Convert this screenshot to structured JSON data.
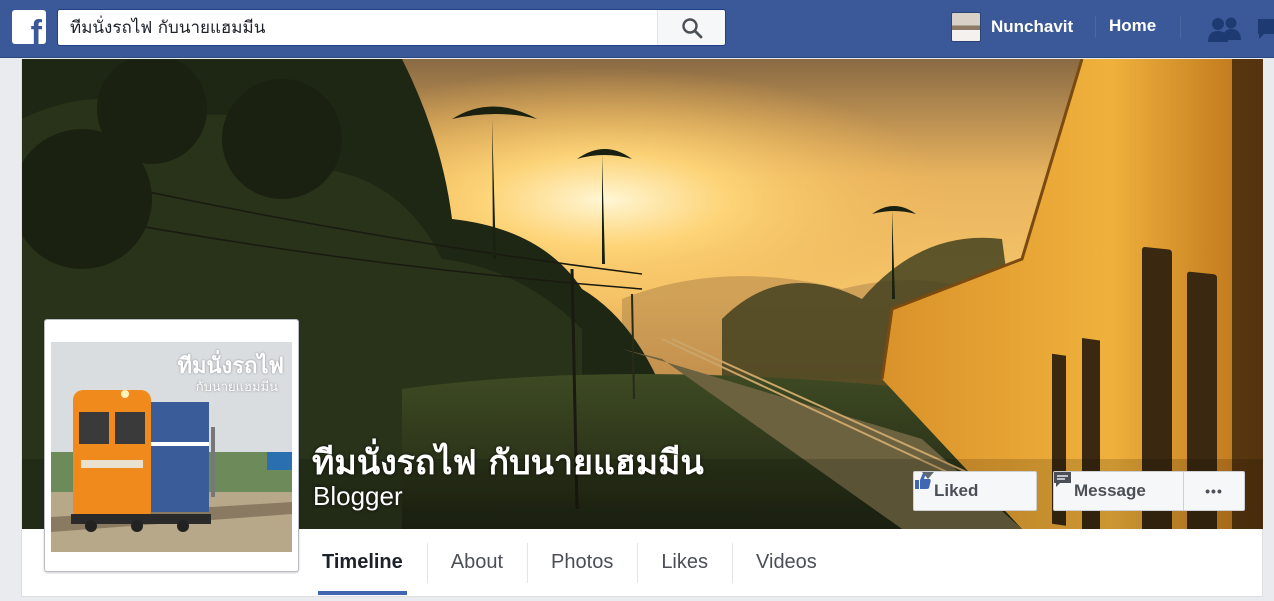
{
  "header": {
    "logo_letter": "f",
    "search_value": "ทีมนั่งรถไฟ กับนายแฮมมีน",
    "user_name": "Nunchavit",
    "home_label": "Home"
  },
  "page": {
    "title": "ทีมนั่งรถไฟ กับนายแฮมมีน",
    "category": "Blogger",
    "profile_title": "ทีมนั่งรถไฟ",
    "profile_subtitle": "กับนายแฮมมีน"
  },
  "actions": {
    "liked_label": "Liked",
    "message_label": "Message",
    "more_label": "•••"
  },
  "tabs": [
    {
      "label": "Timeline",
      "active": true
    },
    {
      "label": "About",
      "active": false
    },
    {
      "label": "Photos",
      "active": false
    },
    {
      "label": "Likes",
      "active": false
    },
    {
      "label": "Videos",
      "active": false
    }
  ],
  "colors": {
    "brand": "#3b5998",
    "tab_underline": "#4267b2"
  },
  "icons": [
    "facebook-logo-icon",
    "search-icon",
    "friends-icon",
    "messages-icon",
    "thumbs-up-icon",
    "caret-down-icon",
    "message-bubble-icon"
  ]
}
